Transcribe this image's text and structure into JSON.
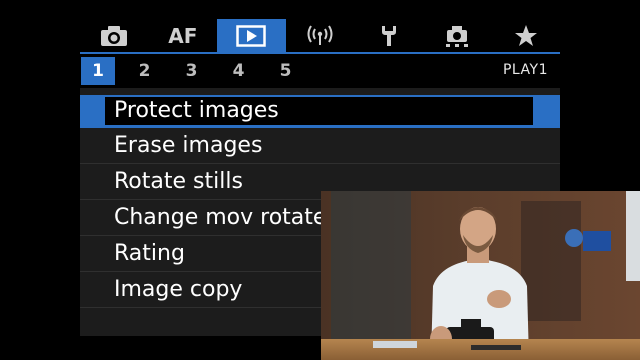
{
  "menu": {
    "tabs": [
      {
        "id": "shooting",
        "icon": "camera-icon",
        "label": ""
      },
      {
        "id": "af",
        "icon": "",
        "label": "AF"
      },
      {
        "id": "playback",
        "icon": "play-icon",
        "label": "",
        "active": true
      },
      {
        "id": "wireless",
        "icon": "wireless-icon",
        "label": ""
      },
      {
        "id": "setup",
        "icon": "wrench-icon",
        "label": ""
      },
      {
        "id": "custom",
        "icon": "custom-functions-icon",
        "label": ""
      },
      {
        "id": "mymenu",
        "icon": "star-icon",
        "label": ""
      }
    ],
    "pages": [
      "1",
      "2",
      "3",
      "4",
      "5"
    ],
    "active_page": "1",
    "page_id": "PLAY1",
    "items": [
      {
        "label": "Protect images",
        "selected": true
      },
      {
        "label": "Erase images"
      },
      {
        "label": "Rotate stills"
      },
      {
        "label": "Change mov rotate"
      },
      {
        "label": "Rating"
      },
      {
        "label": "Image copy"
      }
    ]
  },
  "colors": {
    "accent": "#2a6fc4",
    "background": "#1c1c1c"
  }
}
